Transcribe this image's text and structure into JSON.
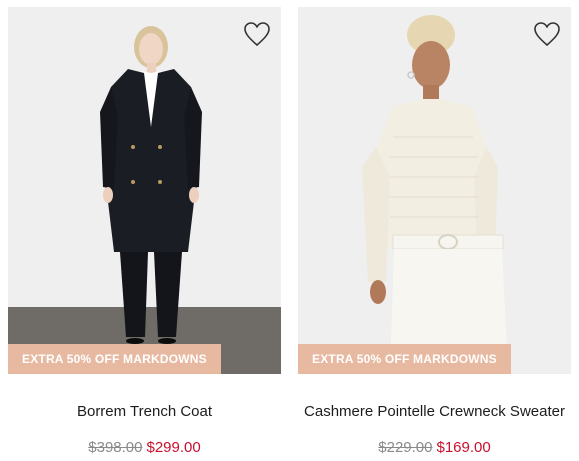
{
  "colors": {
    "badge_bg": "#e8b9a1",
    "sale_price": "#c8102e",
    "heart_stroke": "#333333"
  },
  "products": [
    {
      "name": "Borrem Trench Coat",
      "badge": "EXTRA 50% OFF MARKDOWNS",
      "original_price": "$398.00",
      "sale_price": "$299.00",
      "wishlist_icon": "heart-outline-icon",
      "image": "model-wearing-black-trench-coat"
    },
    {
      "name": "Cashmere Pointelle Crewneck Sweater",
      "badge": "EXTRA 50% OFF MARKDOWNS",
      "original_price": "$229.00",
      "sale_price": "$169.00",
      "wishlist_icon": "heart-outline-icon",
      "image": "model-wearing-cream-pointelle-sweater"
    }
  ]
}
